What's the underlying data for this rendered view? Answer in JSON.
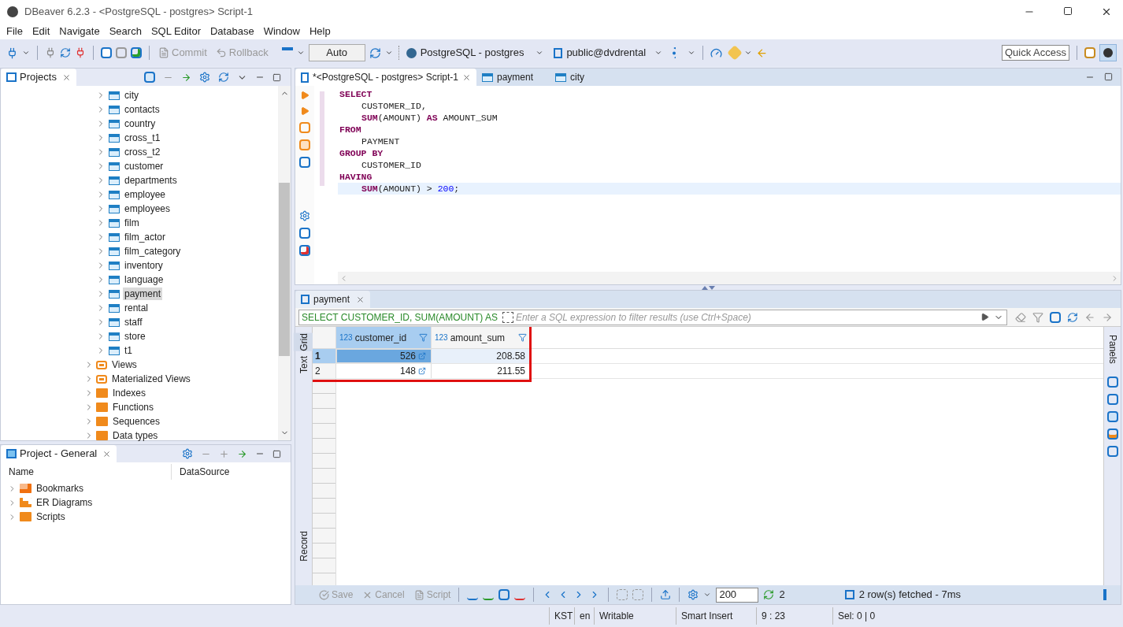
{
  "window": {
    "title": "DBeaver 6.2.3 - <PostgreSQL - postgres> Script-1"
  },
  "menu": [
    "File",
    "Edit",
    "Navigate",
    "Search",
    "SQL Editor",
    "Database",
    "Window",
    "Help"
  ],
  "toolbar": {
    "commit": "Commit",
    "rollback": "Rollback",
    "mode": "Auto",
    "connection": "PostgreSQL - postgres",
    "schema": "public@dvdrental",
    "quick_access": "Quick Access"
  },
  "projects_panel": {
    "title": "Projects",
    "tables": [
      {
        "label": "city",
        "selected": false
      },
      {
        "label": "contacts",
        "selected": false
      },
      {
        "label": "country",
        "selected": false
      },
      {
        "label": "cross_t1",
        "selected": false
      },
      {
        "label": "cross_t2",
        "selected": false
      },
      {
        "label": "customer",
        "selected": false
      },
      {
        "label": "departments",
        "selected": false
      },
      {
        "label": "employee",
        "selected": false
      },
      {
        "label": "employees",
        "selected": false
      },
      {
        "label": "film",
        "selected": false
      },
      {
        "label": "film_actor",
        "selected": false
      },
      {
        "label": "film_category",
        "selected": false
      },
      {
        "label": "inventory",
        "selected": false
      },
      {
        "label": "language",
        "selected": false
      },
      {
        "label": "payment",
        "selected": true
      },
      {
        "label": "rental",
        "selected": false
      },
      {
        "label": "staff",
        "selected": false
      },
      {
        "label": "store",
        "selected": false
      },
      {
        "label": "t1",
        "selected": false
      }
    ],
    "nodes": [
      {
        "label": "Views",
        "kind": "view"
      },
      {
        "label": "Materialized Views",
        "kind": "view"
      },
      {
        "label": "Indexes",
        "kind": "folder"
      },
      {
        "label": "Functions",
        "kind": "folder"
      },
      {
        "label": "Sequences",
        "kind": "folder"
      },
      {
        "label": "Data types",
        "kind": "folder"
      }
    ]
  },
  "general_panel": {
    "title": "Project - General",
    "columns": [
      "Name",
      "DataSource"
    ],
    "items": [
      {
        "label": "Bookmarks",
        "kind": "bookmarks"
      },
      {
        "label": "ER Diagrams",
        "kind": "diagrams"
      },
      {
        "label": "Scripts",
        "kind": "scripts"
      }
    ]
  },
  "editor": {
    "tabs": [
      {
        "label": "*<PostgreSQL - postgres> Script-1",
        "kind": "script",
        "selected": true
      },
      {
        "label": "payment",
        "kind": "table",
        "selected": false
      },
      {
        "label": "city",
        "kind": "table",
        "selected": false
      }
    ],
    "lines": [
      {
        "current": false,
        "indent": false,
        "tokens": [
          {
            "text": "SELECT",
            "kind": "keyword"
          }
        ]
      },
      {
        "current": false,
        "indent": true,
        "tokens": [
          {
            "text": "CUSTOMER_ID,",
            "kind": "plain"
          }
        ]
      },
      {
        "current": false,
        "indent": true,
        "tokens": [
          {
            "text": "SUM",
            "kind": "keyword"
          },
          {
            "text": "(AMOUNT) ",
            "kind": "plain"
          },
          {
            "text": "AS",
            "kind": "keyword"
          },
          {
            "text": " AMOUNT_SUM",
            "kind": "plain"
          }
        ]
      },
      {
        "current": false,
        "indent": false,
        "tokens": [
          {
            "text": "FROM",
            "kind": "keyword"
          }
        ]
      },
      {
        "current": false,
        "indent": true,
        "tokens": [
          {
            "text": "PAYMENT",
            "kind": "plain"
          }
        ]
      },
      {
        "current": false,
        "indent": false,
        "tokens": [
          {
            "text": "GROUP BY",
            "kind": "keyword"
          }
        ]
      },
      {
        "current": false,
        "indent": true,
        "tokens": [
          {
            "text": "CUSTOMER_ID",
            "kind": "plain"
          }
        ]
      },
      {
        "current": false,
        "indent": false,
        "tokens": [
          {
            "text": "HAVING",
            "kind": "keyword"
          }
        ]
      },
      {
        "current": true,
        "indent": true,
        "tokens": [
          {
            "text": "SUM",
            "kind": "keyword"
          },
          {
            "text": "(AMOUNT) > ",
            "kind": "plain"
          },
          {
            "text": "200",
            "kind": "number"
          },
          {
            "text": ";",
            "kind": "plain"
          }
        ]
      }
    ]
  },
  "results": {
    "tab": "payment",
    "query": "SELECT CUSTOMER_ID, SUM(AMOUNT) AS",
    "filter_placeholder": "Enter a SQL expression to filter results (use Ctrl+Space)",
    "side_tabs": [
      {
        "label": "Grid",
        "selected": true
      },
      {
        "label": "Text",
        "selected": false
      },
      {
        "label": "Record",
        "selected": false
      }
    ],
    "panels_label": "Panels",
    "columns": [
      {
        "type": "123",
        "name": "customer_id"
      },
      {
        "type": "123",
        "name": "amount_sum"
      }
    ],
    "rows": [
      {
        "number": "1",
        "selected": true,
        "cells": [
          "526",
          "208.58"
        ]
      },
      {
        "number": "2",
        "selected": false,
        "cells": [
          "148",
          "211.55"
        ]
      }
    ],
    "bottom": {
      "save": "Save",
      "cancel": "Cancel",
      "script": "Script",
      "fetch_size": "200",
      "count": "2",
      "status": "2 row(s) fetched - 7ms"
    }
  },
  "status_bar": [
    "KST",
    "en",
    "Writable",
    "Smart Insert",
    "9 : 23",
    "Sel: 0 | 0"
  ]
}
